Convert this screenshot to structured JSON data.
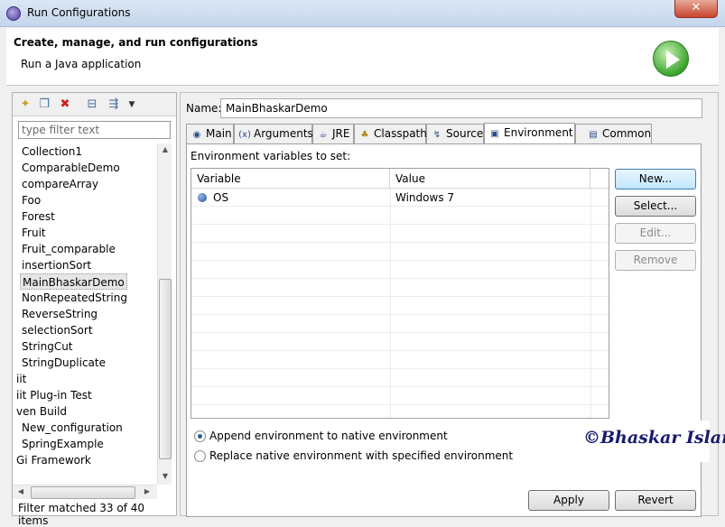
{
  "window": {
    "title": "Run Configurations",
    "close_glyph": "✕"
  },
  "header": {
    "title": "Create, manage, and run configurations",
    "subtitle": "Run a Java application"
  },
  "left": {
    "filter_placeholder": "type filter text",
    "items": [
      "Collection1",
      "ComparableDemo",
      "compareArray",
      "Foo",
      "Forest",
      "Fruit",
      "Fruit_comparable",
      "insertionSort",
      "MainBhaskarDemo",
      "NonRepeatedString",
      "ReverseString",
      "selectionSort",
      "StringCut",
      "StringDuplicate",
      "iit",
      "iit Plug-in Test",
      "ven Build",
      "New_configuration",
      "SpringExample",
      "Gi Framework"
    ],
    "selected": "MainBhaskarDemo",
    "status": "Filter matched 33 of 40 items"
  },
  "right": {
    "name_label": "Name:",
    "name_value": "MainBhaskarDemo",
    "tabs": [
      {
        "label": "Main",
        "icon": "main-tab-icon"
      },
      {
        "label": "Arguments",
        "icon": "arguments-tab-icon"
      },
      {
        "label": "JRE",
        "icon": "jre-tab-icon"
      },
      {
        "label": "Classpath",
        "icon": "classpath-tab-icon"
      },
      {
        "label": "Source",
        "icon": "source-tab-icon"
      },
      {
        "label": "Environment",
        "icon": "environment-tab-icon"
      },
      {
        "label": "Common",
        "icon": "common-tab-icon"
      }
    ],
    "active_tab": "Environment",
    "env_label": "Environment variables to set:",
    "columns": [
      "Variable",
      "Value"
    ],
    "rows": [
      {
        "variable": "OS",
        "value": "Windows 7"
      }
    ],
    "buttons": {
      "new": "New...",
      "select": "Select...",
      "edit": "Edit...",
      "remove": "Remove"
    },
    "radio_append": "Append environment to native environment",
    "radio_replace": "Replace native environment with specified environment",
    "append_selected": true,
    "apply": "Apply",
    "revert": "Revert"
  },
  "watermark": "©Bhaskar Islam",
  "colors": {
    "selection": "#e6e6e6",
    "accent": "#3c7fb1",
    "run_green": "#3aa52c"
  }
}
